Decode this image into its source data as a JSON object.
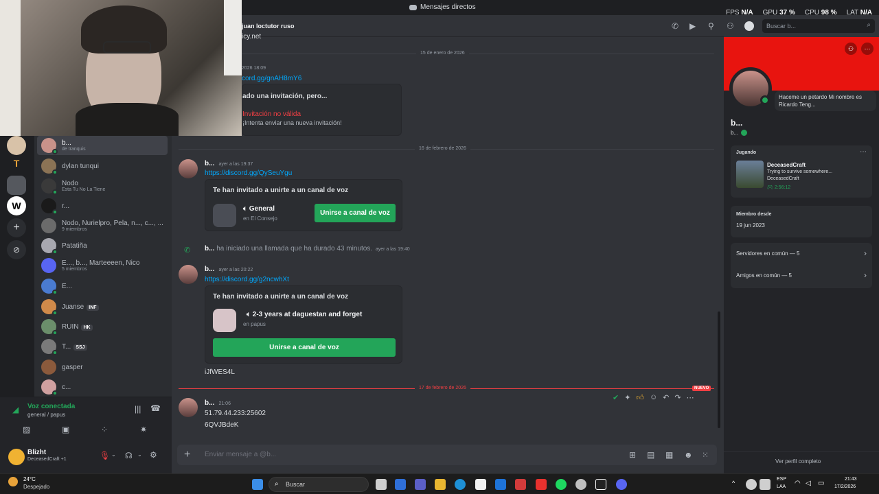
{
  "titlebar": {
    "title": "Mensajes directos"
  },
  "perf": {
    "fps_label": "FPS",
    "fps_value": "N/A",
    "gpu_label": "GPU",
    "gpu_value": "37 %",
    "cpu_label": "CPU",
    "cpu_value": "98 %",
    "lat_label": "LAT",
    "lat_value": "N/A"
  },
  "header": {
    "channel_name": "juan loctutor ruso",
    "search_placeholder": "Buscar b..."
  },
  "dms": [
    {
      "name": "b...",
      "sub": "de tranquis",
      "color": "#c9928a",
      "status": "#23a559"
    },
    {
      "name": "dylan tunqui",
      "sub": "",
      "color": "#8b7355",
      "status": "#23a559"
    },
    {
      "name": "Nodo",
      "sub": "Esta Tu No La Tiene",
      "color": "#3a3a3a",
      "status": "#23a559"
    },
    {
      "name": "r...",
      "sub": "",
      "color": "#1a1a1a",
      "status": "#23a559"
    },
    {
      "name": "Nodo, Nurielpro, Pela, n..., c..., ...",
      "sub": "9 miembros",
      "color": "#6b6b6b",
      "status": ""
    },
    {
      "name": "Patatiña",
      "sub": "",
      "color": "#a8a8b0",
      "status": "#23a559"
    },
    {
      "name": "E..., b..., Marteeeen, Nico",
      "sub": "5 miembros",
      "color": "#5865f2",
      "status": ""
    },
    {
      "name": "E...",
      "sub": "",
      "color": "#4a7bd0",
      "status": "#23a559"
    },
    {
      "name": "Juanse",
      "sub": "",
      "color": "#d08a4a",
      "status": "#23a559",
      "badge": "INF"
    },
    {
      "name": "RUIN",
      "sub": "",
      "color": "#6b8e6b",
      "status": "#23a559",
      "badge": "HK"
    },
    {
      "name": "T...",
      "sub": "",
      "color": "#7a7a7a",
      "status": "#23a559",
      "badge": "SSJ"
    },
    {
      "name": "gasper",
      "sub": "",
      "color": "#8b5a3c",
      "status": ""
    },
    {
      "name": "c...",
      "sub": "",
      "color": "#d0a0a0",
      "status": "#23a559"
    }
  ],
  "voice": {
    "status": "Voz conectada",
    "channel": "general / papus"
  },
  "user": {
    "name": "Blizht",
    "status": "DeceasedCraft +1"
  },
  "chat": {
    "top_fragment": "icy.net",
    "date1": "15 de enero de 2026",
    "msg0_time": "2026 18:09",
    "msg0_link": "cord.gg/gnAH8mY6",
    "msg0_card_title": "ado una invitación, pero...",
    "msg0_card_invalid": "Invitación no válida",
    "msg0_card_retry": "¡Intenta enviar una nueva invitación!",
    "date2": "16 de febrero de 2026",
    "msg1_author": "b...",
    "msg1_time": "ayer a las 19:37",
    "msg1_link": "https://discord.gg/QySeuYgu",
    "invite_title": "Te han invitado a unirte a un canal de voz",
    "msg1_channel": "General",
    "msg1_server": "en El Consejo",
    "join_label": "Unirse a canal de voz",
    "call_author": "b...",
    "call_text": "ha iniciado una llamada que ha durado 43 minutos.",
    "call_time": "ayer a las 19:40",
    "msg2_author": "b...",
    "msg2_time": "ayer a las 20:22",
    "msg2_link": "https://discord.gg/g2ncwhXt",
    "msg2_channel": "2-3 years at daguestan and forget",
    "msg2_server": "en papus",
    "msg2_extra": "iJfWES4L",
    "date3": "17 de febrero de 2026",
    "new_badge": "NUEVO",
    "msg3_author": "b...",
    "msg3_time": "21:06",
    "msg3_line1": "51.79.44.233:25602",
    "msg3_line2": "6QVJBdeK"
  },
  "composer": {
    "placeholder": "Enviar mensaje a @b..."
  },
  "profile": {
    "bubble": "Haceme un petardo Mi nombre es Ricardo Teng...",
    "name": "b...",
    "tag": "b...",
    "playing_label": "Jugando",
    "game": "DeceasedCraft",
    "game_detail": "Trying to survive somewhere...",
    "game_state": "DeceasedCraft",
    "game_time": "2:56:12",
    "member_since_label": "Miembro desde",
    "member_since": "19 jun 2023",
    "servers_common": "Servidores en común — 5",
    "friends_common": "Amigos en común — 5",
    "full_profile": "Ver perfil completo"
  },
  "taskbar": {
    "weather_temp": "24°C",
    "weather_desc": "Despejado",
    "search": "Buscar",
    "lang1": "ESP",
    "lang2": "LAA",
    "time": "21:43",
    "date": "17/2/2026"
  }
}
